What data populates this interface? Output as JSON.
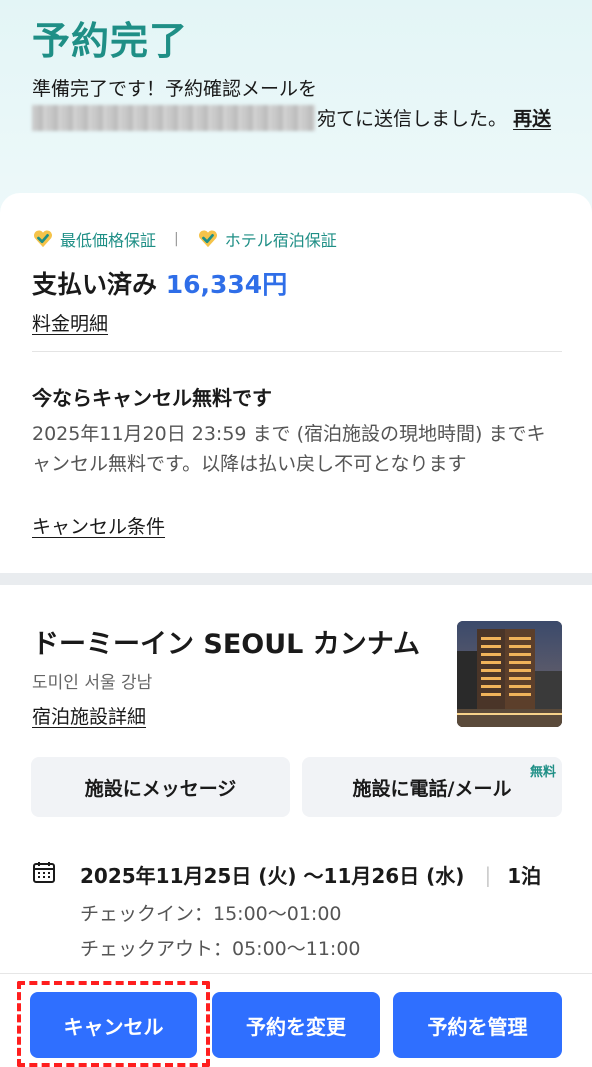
{
  "header": {
    "title": "予約完了",
    "message_prefix": "準備完了です！予約確認メールを",
    "message_suffix": "宛てに送信しました。",
    "resend_link": "再送"
  },
  "summary": {
    "guarantees": [
      "最低価格保証",
      "ホテル宿泊保証"
    ],
    "paid_label": "支払い済み",
    "paid_amount": "16,334円",
    "fee_detail_link": "料金明細",
    "cancel_title": "今ならキャンセル無料です",
    "cancel_desc": "2025年11月20日 23:59 まで (宿泊施設の現地時間) までキャンセル無料です。以降は払い戻し不可となります",
    "cancel_terms_link": "キャンセル条件"
  },
  "hotel": {
    "name": "ドーミーイン SEOUL カンナム",
    "local_name": "도미인 서울 강남",
    "detail_link": "宿泊施設詳細",
    "message_button": "施設にメッセージ",
    "call_button": "施設に電話/メール",
    "free_badge": "無料"
  },
  "stay": {
    "dates": "2025年11月25日 (火) 〜11月26日 (水)",
    "nights": "1泊",
    "checkin": "チェックイン：15:00〜01:00",
    "checkout": "チェックアウト：05:00〜11:00"
  },
  "footer": {
    "cancel_button": "キャンセル",
    "change_button": "予約を変更",
    "manage_button": "予約を管理"
  },
  "colors": {
    "accent_teal": "#1f8f86",
    "price_blue": "#2f6ee8",
    "button_blue": "#2f6fff",
    "highlight_red": "#ff1e1e"
  },
  "icons": [
    "heart-check-icon",
    "calendar-icon"
  ]
}
